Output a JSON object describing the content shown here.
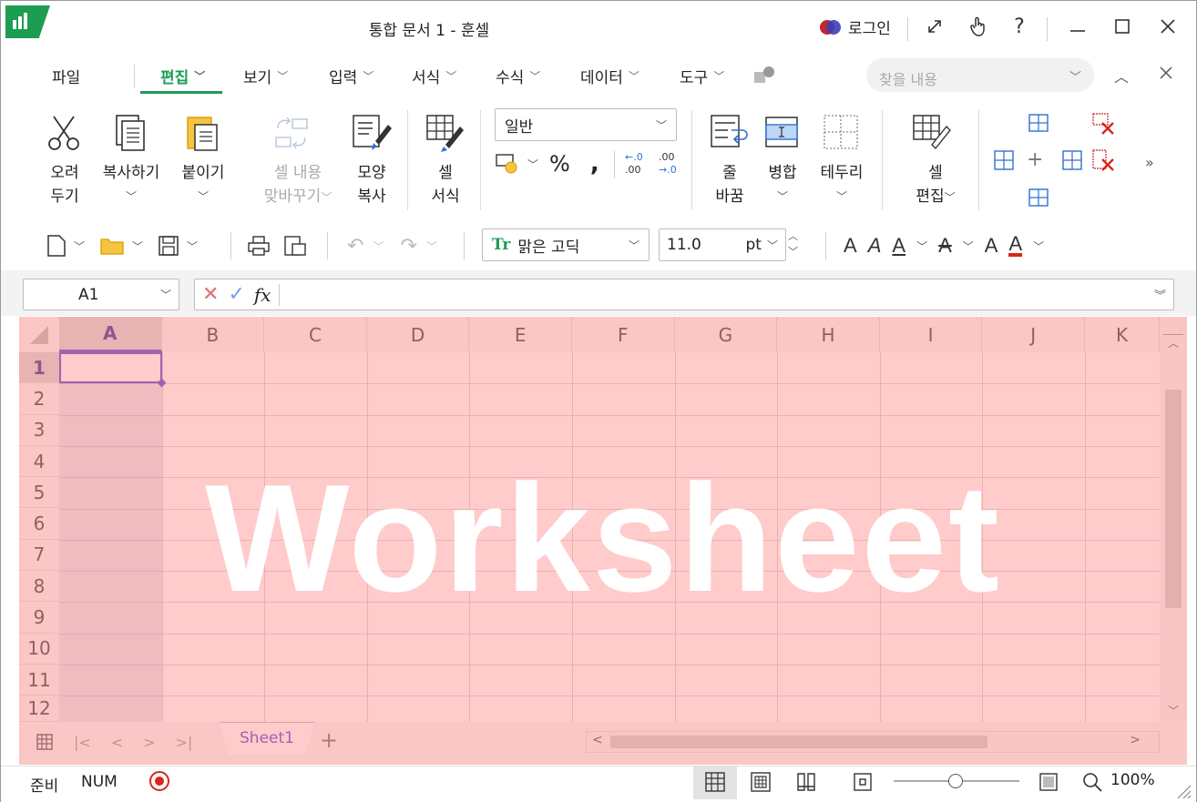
{
  "window": {
    "title": "통합 문서 1 - 훈셀",
    "login": "로그인"
  },
  "menu": {
    "items": [
      "파일",
      "편집",
      "보기",
      "입력",
      "서식",
      "수식",
      "데이터",
      "도구"
    ],
    "search_placeholder": "찾을 내용"
  },
  "ribbon": {
    "cut": [
      "오려",
      "두기"
    ],
    "copy": "복사하기",
    "paste": "붙이기",
    "swap": [
      "셀 내용",
      "맞바꾸기"
    ],
    "format_paint": [
      "모양",
      "복사"
    ],
    "cell_style": [
      "셀",
      "서식"
    ],
    "number_format": "일반",
    "wrap": [
      "줄",
      "바꿈"
    ],
    "merge": "병합",
    "border": "테두리",
    "cell_edit": [
      "셀",
      "편집"
    ],
    "percent": "%",
    "comma": ","
  },
  "toolbar": {
    "font": "맑은 고딕",
    "font_size": "11.0",
    "unit": "pt"
  },
  "formula": {
    "name_box": "A1",
    "fx": "fx"
  },
  "sheet": {
    "columns": [
      "A",
      "B",
      "C",
      "D",
      "E",
      "F",
      "G",
      "H",
      "I",
      "J",
      "K"
    ],
    "rows": [
      "1",
      "2",
      "3",
      "4",
      "5",
      "6",
      "7",
      "8",
      "9",
      "10",
      "11",
      "12"
    ],
    "watermark": "Worksheet",
    "tab": "Sheet1"
  },
  "status": {
    "ready": "준비",
    "num": "NUM",
    "zoom": "100%"
  },
  "colors": {
    "accent": "#1d9d52",
    "tab_text": "#5b4fd0",
    "overlay": "#ff8282"
  }
}
